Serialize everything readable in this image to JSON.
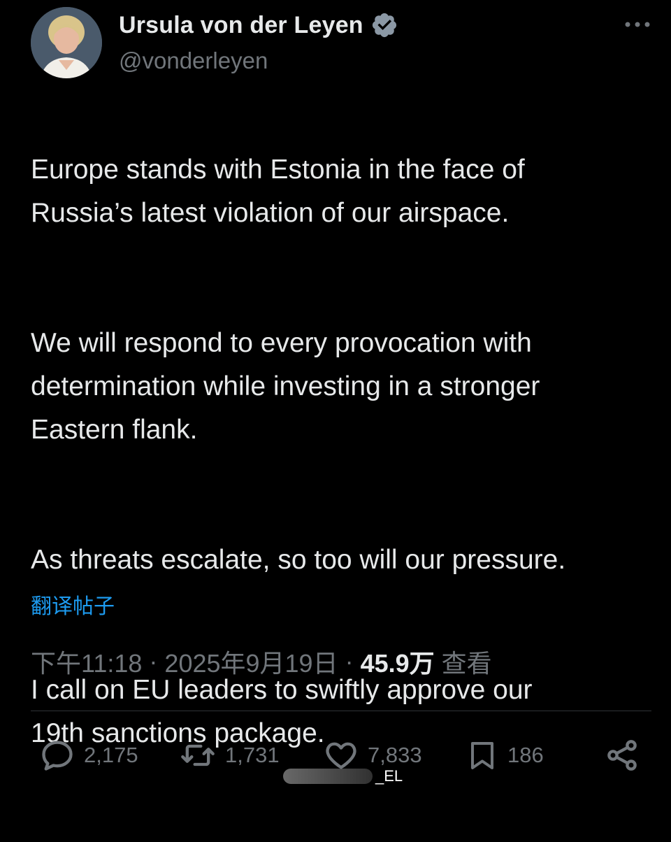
{
  "header": {
    "display_name": "Ursula von der Leyen",
    "handle": "@vonderleyen",
    "verified": true,
    "more_icon": "more-dots-icon"
  },
  "tweet": {
    "paragraphs": [
      "Europe stands with Estonia in the face of\nRussia’s latest violation of our airspace.",
      "We will respond to every provocation with\ndetermination while investing in a stronger\nEastern flank.",
      "As threats escalate, so too will our pressure.",
      "I call on EU leaders to swiftly approve our\n19th sanctions package."
    ],
    "translate_label": "翻译帖子"
  },
  "meta": {
    "time": "下午11:18",
    "date": "2025年9月19日",
    "separator": "·",
    "views_count": "45.9万",
    "views_label": "查看"
  },
  "actions": {
    "replies": "2,175",
    "reposts": "1,731",
    "likes": "7,833",
    "bookmarks": "186",
    "icons": [
      "reply-icon",
      "repost-icon",
      "like-icon",
      "bookmark-icon",
      "share-icon"
    ]
  },
  "watermark": {
    "text": "_EL"
  },
  "colors": {
    "background": "#000000",
    "text_primary": "#e7e9ea",
    "text_secondary": "#71767b",
    "accent": "#1d9bf0",
    "divider": "#2f3336"
  }
}
